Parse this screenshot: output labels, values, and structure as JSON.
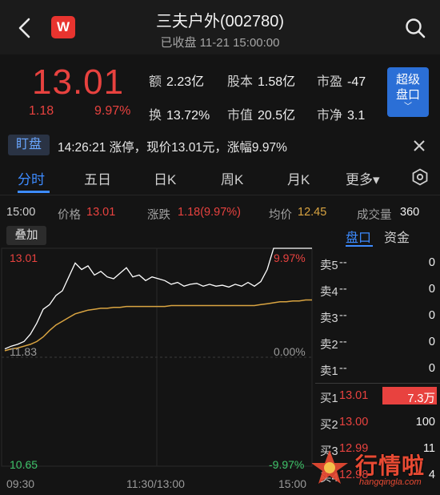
{
  "header": {
    "title": "三夫户外(002780)",
    "status": "已收盘 11-21 15:00:00",
    "logo_text": "W"
  },
  "quote": {
    "price": "13.01",
    "change": "1.18",
    "change_pct": "9.97%",
    "stats": {
      "turnover_amount": {
        "label": "额",
        "value": "2.23亿"
      },
      "share_capital": {
        "label": "股本",
        "value": "1.58亿"
      },
      "pe": {
        "label": "市盈",
        "value": "-47"
      },
      "turnover_rate": {
        "label": "换",
        "value": "13.72%"
      },
      "market_cap": {
        "label": "市值",
        "value": "20.5亿"
      },
      "pb": {
        "label": "市净",
        "value": "3.1"
      }
    },
    "super_button": {
      "line1": "超级",
      "line2": "盘口",
      "chevron": "﹀"
    }
  },
  "alert": {
    "tag": "盯盘",
    "text": "14:26:21 涨停，现价13.01元，涨幅9.97%"
  },
  "tabs": [
    {
      "label": "分时",
      "active": true
    },
    {
      "label": "五日",
      "active": false
    },
    {
      "label": "日K",
      "active": false
    },
    {
      "label": "周K",
      "active": false
    },
    {
      "label": "月K",
      "active": false
    },
    {
      "label": "更多▾",
      "active": false
    }
  ],
  "info_line": {
    "time": "15:00",
    "price_label": "价格",
    "price_value": "13.01",
    "change_label": "涨跌",
    "change_value": "1.18(9.97%)",
    "avg_label": "均价",
    "avg_value": "12.45",
    "volume_label": "成交量",
    "volume_value": "360"
  },
  "chart": {
    "overlay_button": "叠加",
    "y_top_left": "13.01",
    "y_top_right": "9.97%",
    "y_mid_left": "11.83",
    "y_mid_right": "0.00%",
    "y_bot_left": "10.65",
    "y_bot_right": "-9.97%",
    "time_labels": [
      "09:30",
      "11:30/13:00",
      "15:00"
    ]
  },
  "chart_data": {
    "type": "line",
    "title": "",
    "xlabel": "",
    "ylabel": "",
    "ylim": [
      10.65,
      13.01
    ],
    "x": [
      "09:30",
      "09:35",
      "09:40",
      "09:45",
      "09:50",
      "09:55",
      "10:00",
      "10:05",
      "10:10",
      "10:15",
      "10:20",
      "10:25",
      "10:30",
      "10:35",
      "10:40",
      "10:45",
      "10:50",
      "10:55",
      "11:00",
      "11:05",
      "11:10",
      "11:15",
      "11:20",
      "11:25",
      "11:30",
      "13:05",
      "13:10",
      "13:15",
      "13:20",
      "13:25",
      "13:30",
      "13:35",
      "13:40",
      "13:45",
      "13:50",
      "13:55",
      "14:00",
      "14:05",
      "14:10",
      "14:15",
      "14:20",
      "14:25",
      "14:30",
      "14:35",
      "14:40",
      "14:45",
      "14:50",
      "14:55",
      "15:00"
    ],
    "series": [
      {
        "name": "价格",
        "color": "#ffffff",
        "values": [
          11.92,
          11.95,
          11.97,
          12.0,
          12.08,
          12.2,
          12.35,
          12.4,
          12.5,
          12.55,
          12.7,
          12.85,
          12.78,
          12.82,
          12.72,
          12.76,
          12.7,
          12.68,
          12.74,
          12.8,
          12.7,
          12.72,
          12.66,
          12.7,
          12.68,
          12.66,
          12.62,
          12.64,
          12.6,
          12.62,
          12.63,
          12.6,
          12.62,
          12.6,
          12.61,
          12.59,
          12.62,
          12.6,
          12.64,
          12.6,
          12.65,
          12.78,
          13.01,
          13.01,
          13.01,
          13.01,
          13.01,
          13.01,
          13.01
        ]
      },
      {
        "name": "均价",
        "color": "#d9a441",
        "values": [
          11.9,
          11.92,
          11.93,
          11.95,
          11.97,
          12.0,
          12.05,
          12.12,
          12.18,
          12.22,
          12.26,
          12.3,
          12.32,
          12.34,
          12.35,
          12.36,
          12.36,
          12.37,
          12.37,
          12.38,
          12.38,
          12.38,
          12.38,
          12.38,
          12.38,
          12.38,
          12.39,
          12.39,
          12.39,
          12.39,
          12.39,
          12.39,
          12.39,
          12.39,
          12.39,
          12.39,
          12.39,
          12.39,
          12.39,
          12.39,
          12.4,
          12.41,
          12.42,
          12.43,
          12.43,
          12.44,
          12.44,
          12.45,
          12.45
        ]
      }
    ]
  },
  "order_book": {
    "tabs": [
      {
        "label": "盘口",
        "active": true
      },
      {
        "label": "资金",
        "active": false
      }
    ],
    "asks": [
      {
        "label": "卖5",
        "price": "--",
        "volume": "0"
      },
      {
        "label": "卖4",
        "price": "--",
        "volume": "0"
      },
      {
        "label": "卖3",
        "price": "--",
        "volume": "0"
      },
      {
        "label": "卖2",
        "price": "--",
        "volume": "0"
      },
      {
        "label": "卖1",
        "price": "--",
        "volume": "0"
      }
    ],
    "bids": [
      {
        "label": "买1",
        "price": "13.01",
        "volume": "7.3万",
        "bar_fraction": 0.5
      },
      {
        "label": "买2",
        "price": "13.00",
        "volume": "100",
        "bar_fraction": 0.0
      },
      {
        "label": "买3",
        "price": "12.99",
        "volume": "11",
        "bar_fraction": 0.0
      },
      {
        "label": "买4",
        "price": "12.98",
        "volume": "4",
        "bar_fraction": 0.0
      }
    ]
  },
  "watermark": {
    "text": "行情啦",
    "url": "hangqingla.com"
  },
  "colors": {
    "up": "#e8423f",
    "down": "#3fc46a",
    "accent": "#3d8bff",
    "avg_line": "#d9a441"
  }
}
